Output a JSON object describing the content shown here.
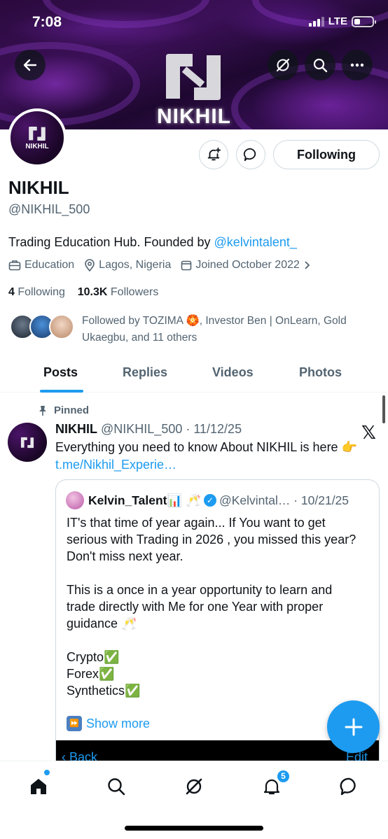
{
  "status_bar": {
    "time": "7:08",
    "network": "LTE"
  },
  "banner": {
    "logo_word": "NIKHIL"
  },
  "avatar": {
    "text": "NIKHIL"
  },
  "actions": {
    "following_label": "Following"
  },
  "profile": {
    "name": "NIKHIL",
    "handle": "@NIKHIL_500",
    "bio_text": "Trading Education Hub. Founded by ",
    "bio_link": "@kelvintalent_",
    "category": "Education",
    "location": "Lagos, Nigeria",
    "joined": "Joined October 2022",
    "following_count": "4",
    "following_label": "Following",
    "followers_count": "10.3K",
    "followers_label": "Followers",
    "followed_by": "Followed by TOZIMA 🏵️, Investor Ben | OnLearn, Gold Ukaegbu, and 11 others"
  },
  "tabs": [
    {
      "label": "Posts"
    },
    {
      "label": "Replies"
    },
    {
      "label": "Videos"
    },
    {
      "label": "Photos"
    }
  ],
  "post": {
    "pinned_label": "Pinned",
    "author_name": "NIKHIL",
    "author_meta": "@NIKHIL_500 · 11/12/25",
    "text": "Everything you need to know About NIKHIL is here 👉",
    "link": "t.me/Nikhil_Experie…",
    "quote": {
      "name": "Kelvin_Talent📊 🥂",
      "meta": "@Kelvintal… · 10/21/25",
      "body": "IT's that time of year again... If You want to get serious with Trading in 2026 , you missed this year? Don't miss next year.\n\nThis is a once in a year opportunity to learn and trade directly with Me for one Year with  proper guidance 🥂\n\nCrypto✅\nForex✅\nSynthetics✅",
      "show_more": "Show more",
      "media_back": "‹ Back",
      "media_edit": "Edit"
    }
  },
  "bottom_nav": {
    "notification_badge": "5"
  },
  "colors": {
    "accent": "#1d9bf0",
    "text": "#0f1419",
    "muted": "#536471",
    "banner": "#3c1058"
  }
}
